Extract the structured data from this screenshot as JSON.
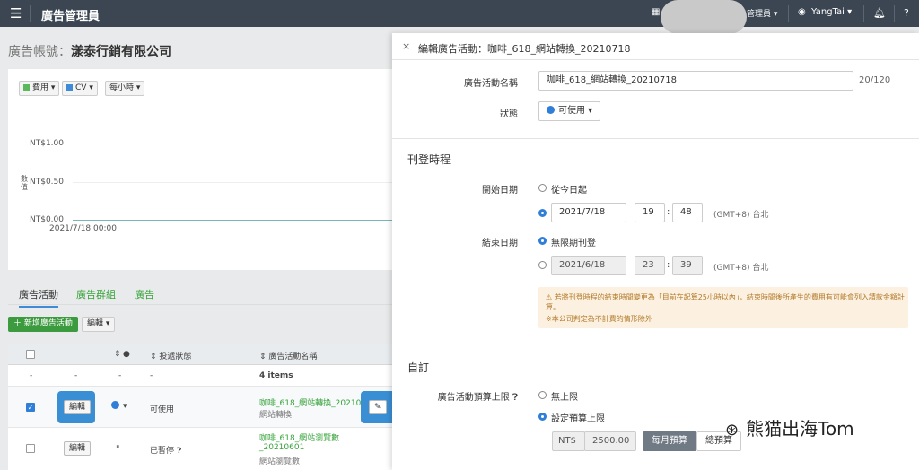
{
  "topbar": {
    "menu_icon": "hamburger-icon",
    "brand": "廣告管理員",
    "role": "管理員",
    "user": "YangTai",
    "notif_icon": "bell-icon",
    "help_icon": "help-icon"
  },
  "account": {
    "label": "廣告帳號：",
    "name": "漾泰行銷有限公司"
  },
  "chart_controls": {
    "metric1": "費用",
    "metric2": "CV",
    "interval": "每小時",
    "metric1_color": "#5cb85c",
    "metric2_color": "#3f8bd6"
  },
  "chart_data": {
    "type": "line",
    "title": "",
    "xlabel": "",
    "ylabel": "數值",
    "x": [
      "2021/7/18 00:00"
    ],
    "y_ticks": [
      "NT$1.00",
      "NT$0.50",
      "NT$0.00"
    ],
    "ylim": [
      0,
      1
    ],
    "series": [
      {
        "values": [
          0,
          0
        ]
      }
    ],
    "grid": true
  },
  "tabs": {
    "campaign": "廣告活動",
    "group": "廣告群組",
    "ad": "廣告"
  },
  "toolbar": {
    "new_campaign": "新增廣告活動",
    "edit": "編輯"
  },
  "table": {
    "headers": {
      "status_icon": "●",
      "delivery": "投遞狀態",
      "name": "廣告活動名稱"
    },
    "summary": {
      "dash1": "-",
      "dash2": "-",
      "dash3": "-",
      "dash4": "-",
      "items": "4 items"
    },
    "rows": [
      {
        "edit": "編輯",
        "delivery": "可使用",
        "name": "咖啡_618_網站轉換_20210718",
        "sub": "網站轉換"
      },
      {
        "edit": "編輯",
        "delivery": "已暫停",
        "name_line1": "咖啡_618_網站瀏覽數",
        "name_line2": "_20210601",
        "sub": "網站瀏覽數"
      }
    ]
  },
  "panel": {
    "close": "×",
    "title": "編輯廣告活動：咖啡_618_網站轉換_20210718",
    "name_label": "廣告活動名稱",
    "name_value": "咖啡_618_網站轉換_20210718",
    "name_count": "20/120",
    "status_label": "狀態",
    "status_value": "可使用",
    "schedule_section": "刊登時程",
    "start_label": "開始日期",
    "start_opt1": "從今日起",
    "start_date": "2021/7/18",
    "start_hour": "19",
    "start_min": "48",
    "tz": "(GMT+8) 台北",
    "end_label": "結束日期",
    "end_opt1": "無限期刊登",
    "end_date": "2021/6/18",
    "end_hour": "23",
    "end_min": "39",
    "tz2": "(GMT+8) 台北",
    "warn1": "若將刊登時程的結束時間變更為「目前在起算25小時以內」，結束時間後所產生的費用有可能會列入請款金額計算。",
    "warn2": "※本公司判定為不計費的情形除外",
    "custom_section": "自訂",
    "budget_label": "廣告活動預算上限",
    "budget_opt1": "無上限",
    "budget_opt2": "設定預算上限",
    "currency": "NT$",
    "budget_amount": "2500.00",
    "monthly": "每月預算",
    "total": "總預算"
  },
  "watermark": "熊猫出海Tom"
}
